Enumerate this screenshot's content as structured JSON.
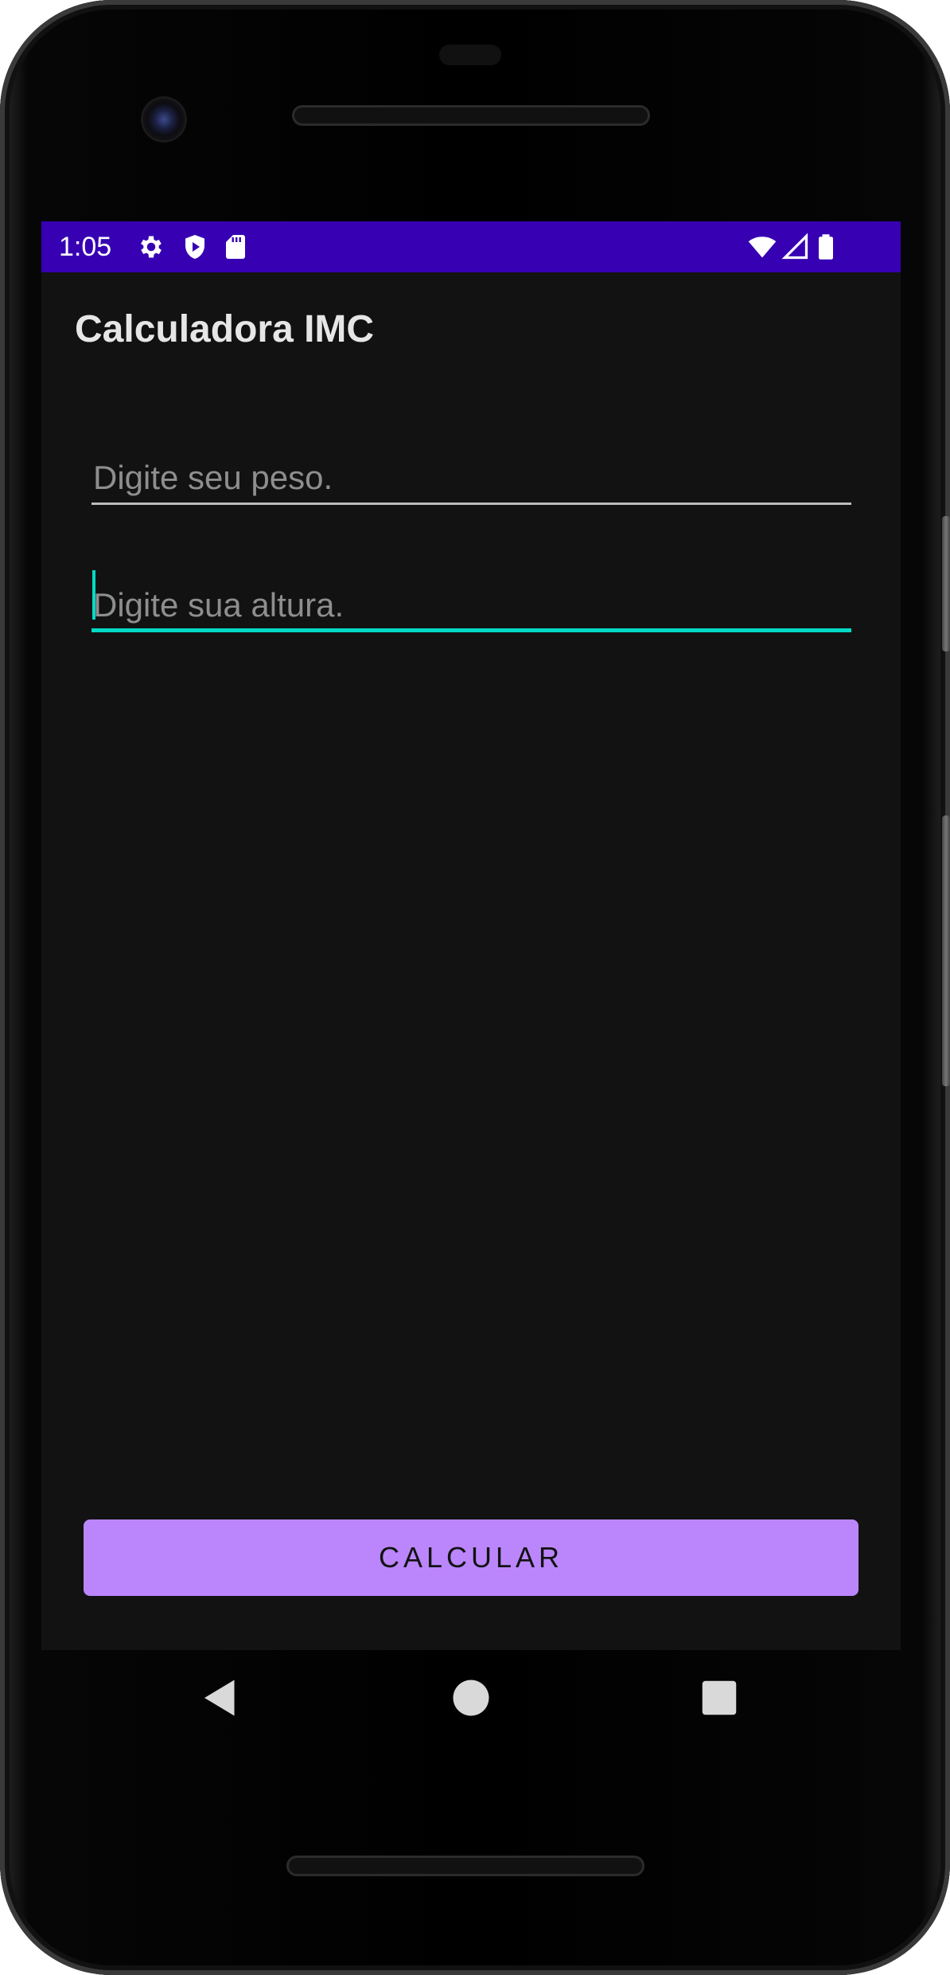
{
  "status_bar": {
    "time": "1:05",
    "left_icons": [
      "gear-icon",
      "shield-play-icon",
      "sd-card-icon"
    ],
    "right_icons": [
      "wifi-icon",
      "cell-signal-icon",
      "battery-icon"
    ],
    "color": "#3700b3"
  },
  "app": {
    "title": "Calculadora IMC",
    "weight_field": {
      "placeholder": "Digite seu peso.",
      "value": ""
    },
    "height_field": {
      "placeholder": "Digite sua altura.",
      "value": ""
    },
    "calculate_button": "CALCULAR",
    "colors": {
      "background": "#121212",
      "accent": "#03dac5",
      "button": "#bb86fc"
    }
  },
  "nav_bar": {
    "buttons": [
      "back-icon",
      "home-icon",
      "recents-icon"
    ]
  }
}
